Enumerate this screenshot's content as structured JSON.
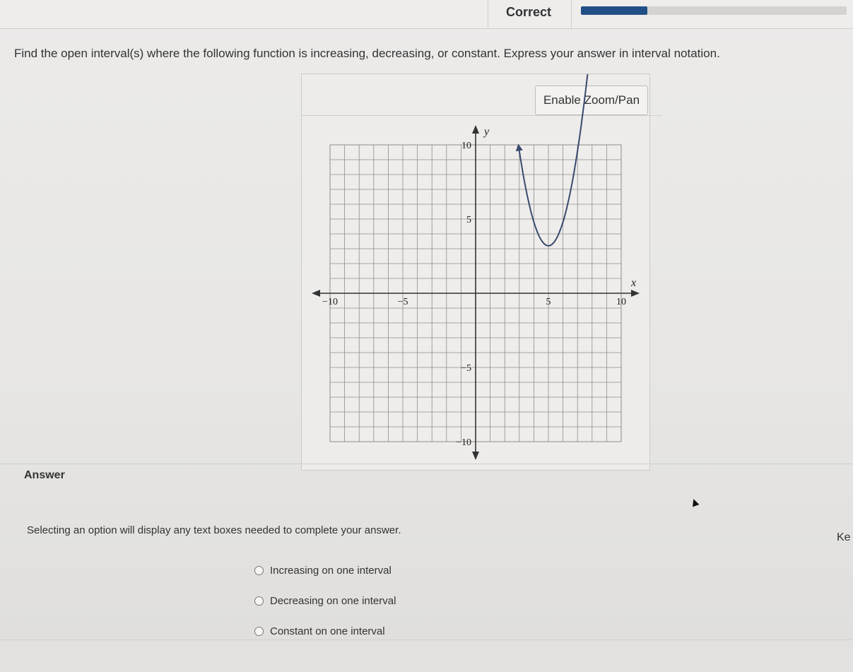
{
  "header": {
    "status": "Correct",
    "progress_fraction": 0.25
  },
  "question": {
    "text": "Find the open interval(s) where the following function is increasing, decreasing, or constant. Express your answer in interval notation."
  },
  "graph_panel": {
    "zoom_button_label": "Enable Zoom/Pan"
  },
  "chart_data": {
    "type": "line",
    "xlabel": "x",
    "ylabel": "y",
    "xlim": [
      -10,
      10
    ],
    "ylim": [
      -10,
      10
    ],
    "grid": true,
    "x_ticks": [
      {
        "value": -10,
        "label": "−10"
      },
      {
        "value": -5,
        "label": "−5"
      },
      {
        "value": 5,
        "label": "5"
      },
      {
        "value": 10,
        "label": "10"
      }
    ],
    "y_ticks": [
      {
        "value": 10,
        "label": "10"
      },
      {
        "value": 5,
        "label": "5"
      },
      {
        "value": -5,
        "label": "−5"
      },
      {
        "value": -10,
        "label": "−10"
      }
    ],
    "curve_color": "#3a4a6e",
    "series": [
      {
        "x": [
          3,
          4,
          5,
          6,
          8
        ],
        "y": [
          9.6,
          5.6,
          3.2,
          4.0,
          9.6
        ],
        "vertex": [
          5,
          3.2
        ],
        "ends": "arrows"
      }
    ]
  },
  "answer": {
    "label": "Answer",
    "instruction": "Selecting an option will display any text boxes needed to complete your answer.",
    "side_text": "Ke",
    "options": [
      {
        "label": "Increasing on one interval"
      },
      {
        "label": "Decreasing on one interval"
      },
      {
        "label": "Constant on one interval"
      }
    ]
  }
}
